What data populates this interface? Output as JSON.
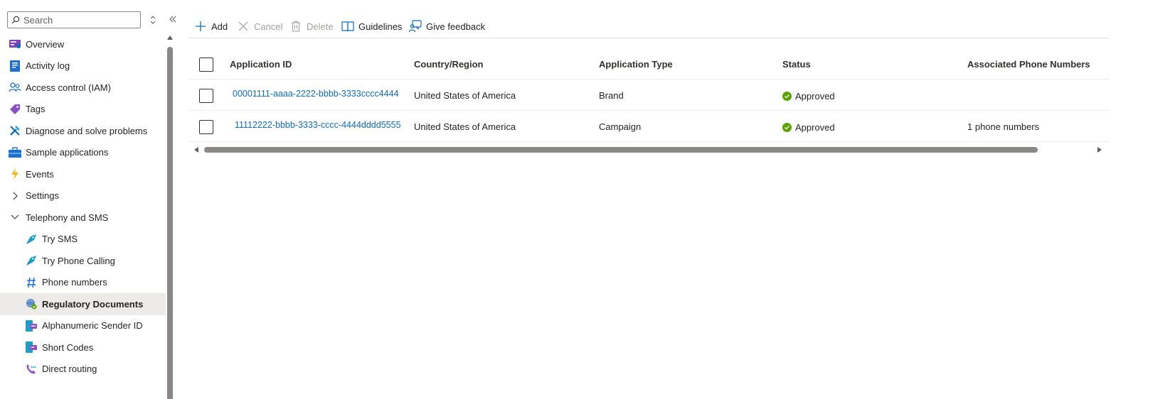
{
  "sidebar": {
    "search": {
      "placeholder": "Search"
    },
    "items": [
      {
        "label": "Overview",
        "icon": "overview-icon"
      },
      {
        "label": "Activity log",
        "icon": "activity-log-icon"
      },
      {
        "label": "Access control (IAM)",
        "icon": "people-icon"
      },
      {
        "label": "Tags",
        "icon": "tag-icon"
      },
      {
        "label": "Diagnose and solve problems",
        "icon": "wrench-icon"
      },
      {
        "label": "Sample applications",
        "icon": "toolbox-icon"
      },
      {
        "label": "Events",
        "icon": "lightning-icon"
      },
      {
        "label": "Settings",
        "icon": "chevron-right-icon"
      },
      {
        "label": "Telephony and SMS",
        "icon": "chevron-down-icon"
      },
      {
        "label": "Try SMS",
        "icon": "rocket-icon"
      },
      {
        "label": "Try Phone Calling",
        "icon": "rocket-icon"
      },
      {
        "label": "Phone numbers",
        "icon": "hash-icon"
      },
      {
        "label": "Regulatory Documents",
        "icon": "document-check-icon",
        "selected": true
      },
      {
        "label": "Alphanumeric Sender ID",
        "icon": "sender-id-icon"
      },
      {
        "label": "Short Codes",
        "icon": "short-code-icon"
      },
      {
        "label": "Direct routing",
        "icon": "phone-routing-icon"
      }
    ]
  },
  "toolbar": {
    "add": "Add",
    "cancel": "Cancel",
    "delete": "Delete",
    "guidelines": "Guidelines",
    "feedback": "Give feedback"
  },
  "table": {
    "columns": [
      "Application ID",
      "Country/Region",
      "Application Type",
      "Status",
      "Associated Phone Numbers"
    ],
    "rows": [
      {
        "id": "00001111-aaaa-2222-bbbb-3333cccc4444",
        "country": "United States of America",
        "type": "Brand",
        "status": "Approved",
        "phones": ""
      },
      {
        "id": "11112222-bbbb-3333-cccc-4444dddd5555",
        "country": "United States of America",
        "type": "Campaign",
        "status": "Approved",
        "phones": "1 phone numbers"
      }
    ]
  },
  "colors": {
    "accent": "#0f6cbd",
    "approved": "#57a300",
    "selected_bg": "#edebe9"
  }
}
